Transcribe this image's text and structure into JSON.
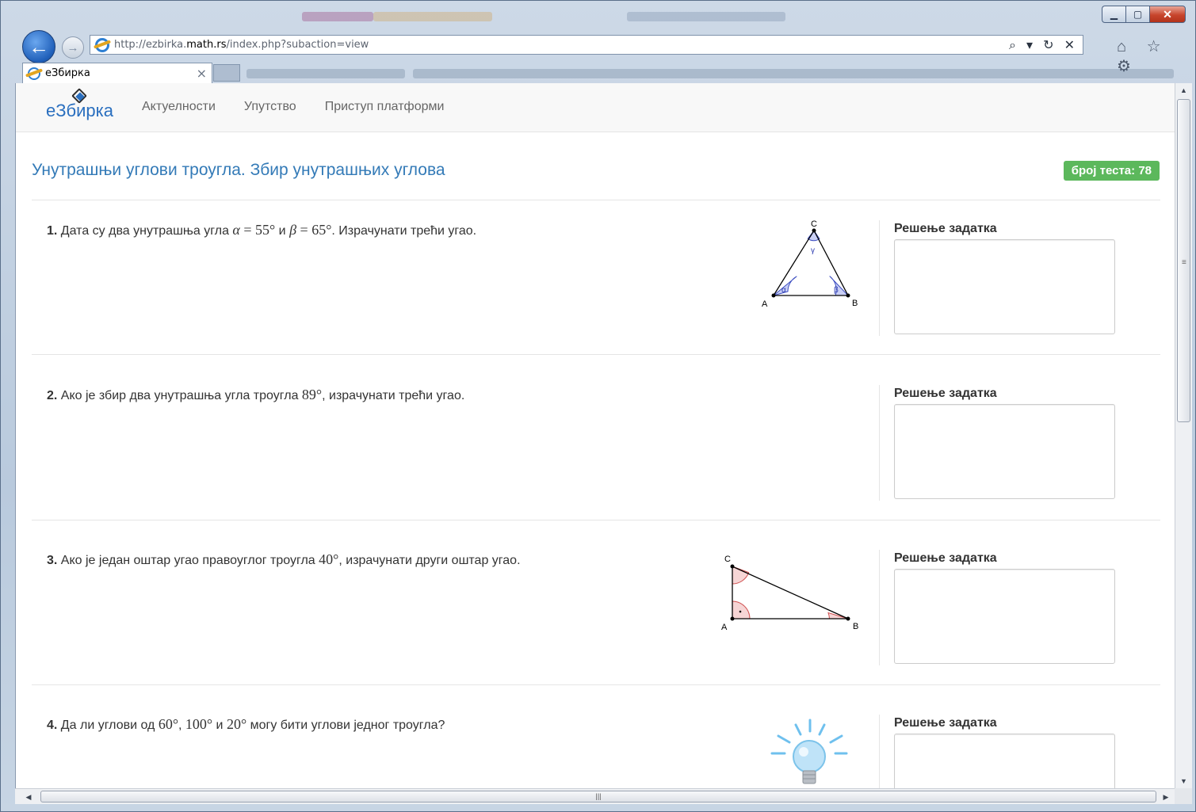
{
  "browser": {
    "url_prefix": "http://ezbirka.",
    "url_host": "math.rs",
    "url_path": "/index.php?subaction=view",
    "tab_title": "еЗбирка",
    "address_tools": "⌕ ▾ ↻ ✕",
    "toolbar_icons": "⌂ ☆ ⚙",
    "window_controls": {
      "minimize": "▁",
      "maximize": "▢",
      "close": "✕"
    }
  },
  "site": {
    "logo_text": "еЗбирка",
    "nav": [
      "Актуелности",
      "Упутство",
      "Приступ платформи"
    ]
  },
  "page": {
    "title": "Унутрашњи углови троугла. Збир унутрашњих углова",
    "badge": "број теста: 78"
  },
  "solution_label": "Решење задатка",
  "tasks": [
    {
      "number": "1.",
      "parts": [
        "Дата су два унутрашња угла ",
        "α",
        " = ",
        "55°",
        " и ",
        "β",
        " = ",
        "65°",
        ". Израчунати трећи угао."
      ]
    },
    {
      "number": "2.",
      "parts": [
        "Ако је збир два унутрашња угла троугла ",
        "89°",
        ", израчунати трећи угао."
      ]
    },
    {
      "number": "3.",
      "parts": [
        "Ако је један оштар угао правоуглог троугла ",
        "40°",
        ", израчунати други оштар угао."
      ]
    },
    {
      "number": "4.",
      "parts": [
        "Да ли углови од ",
        "60°",
        ", ",
        "100°",
        " и ",
        "20°",
        " могу бити углови једног троугла?"
      ]
    }
  ],
  "figures": {
    "triangle1": {
      "A": "A",
      "B": "B",
      "C": "C",
      "alpha": "α",
      "beta": "β",
      "gamma": "γ"
    },
    "triangle3": {
      "A": "A",
      "B": "B",
      "C": "C"
    }
  },
  "colors": {
    "link_blue": "#337ab7",
    "badge_green": "#5cb85c",
    "angle_blue_fill": "#c9cff5",
    "angle_red_fill": "#f6d5d5"
  }
}
